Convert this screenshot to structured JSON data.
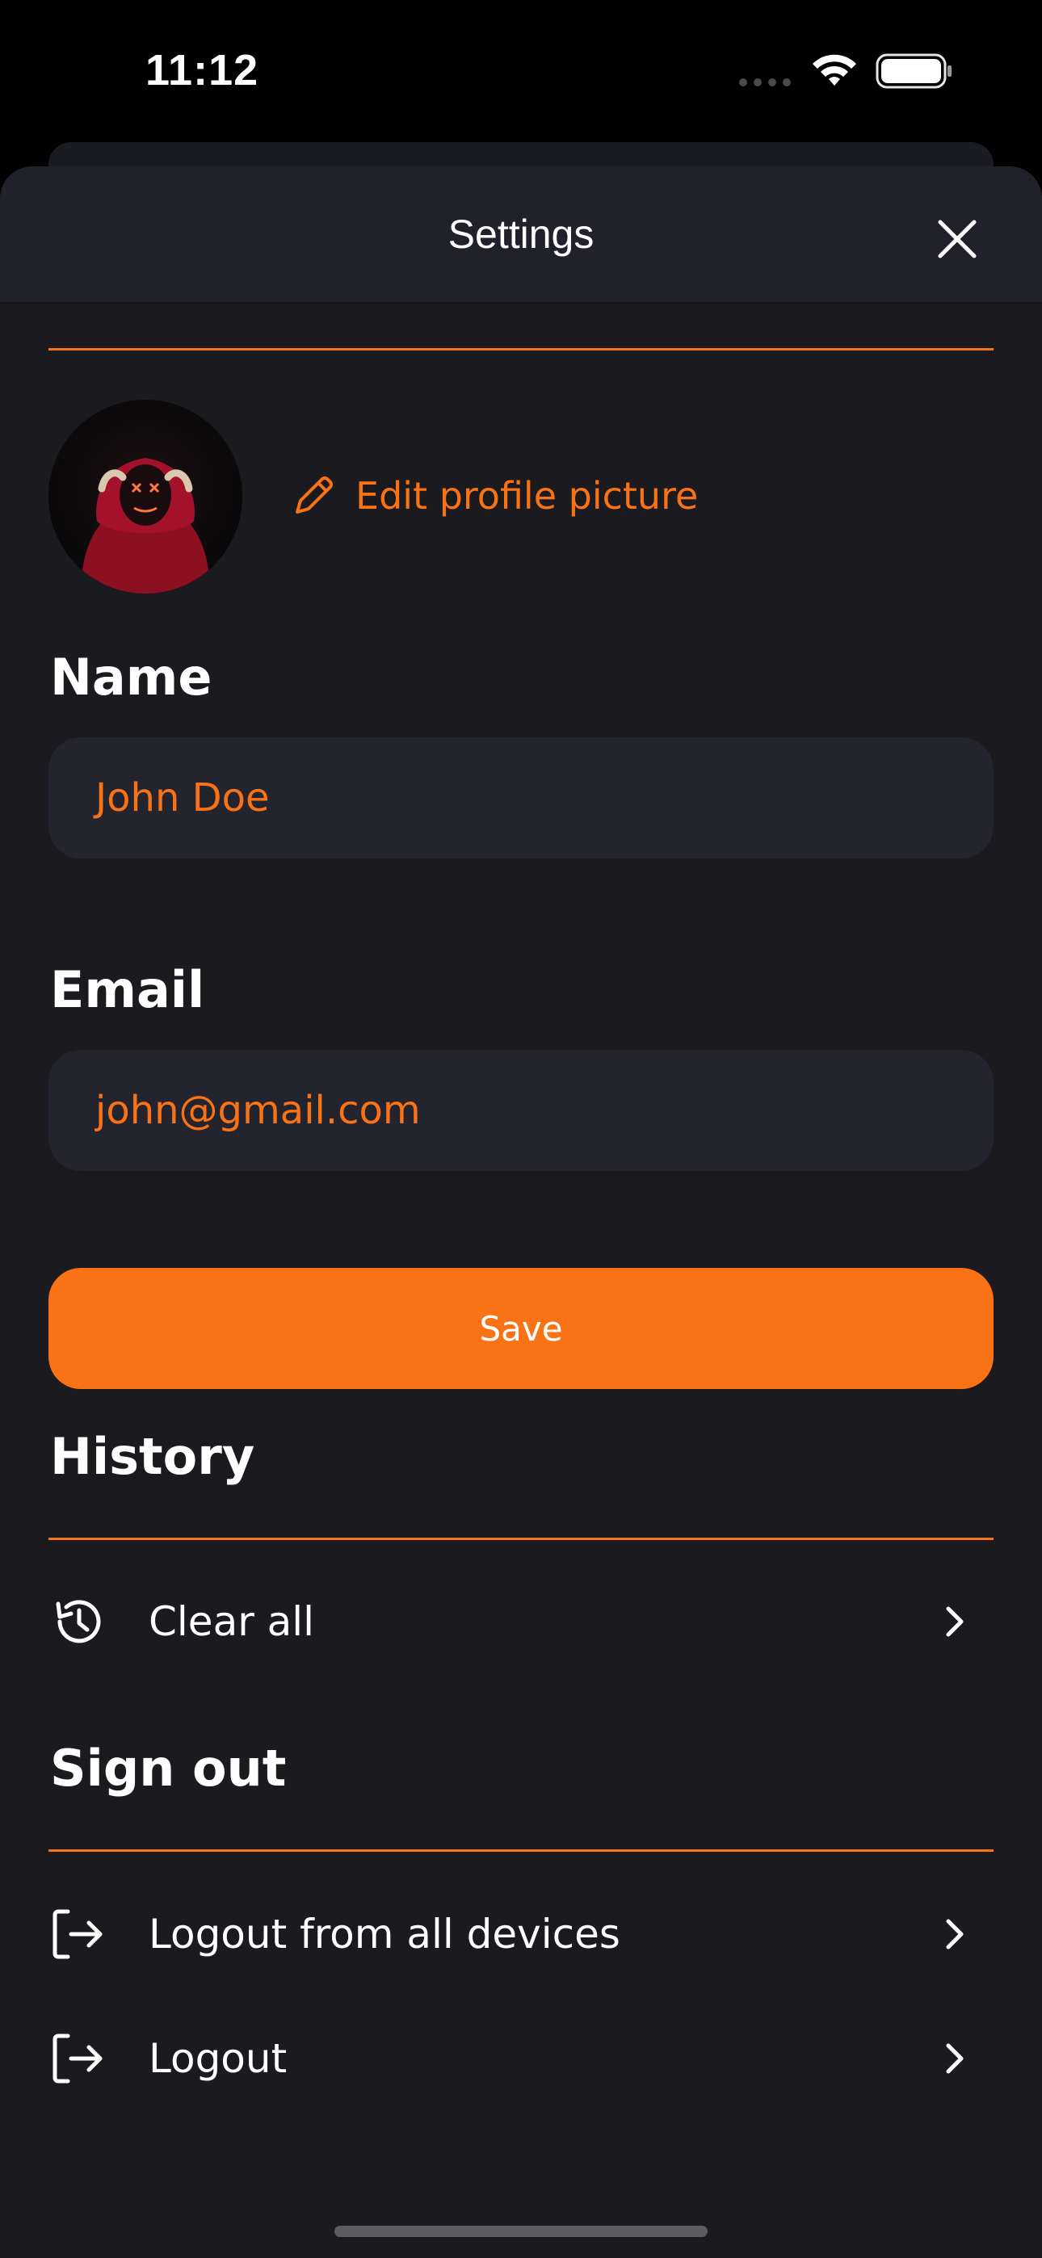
{
  "status_bar": {
    "time": "11:12"
  },
  "sheet": {
    "title": "Settings"
  },
  "profile": {
    "edit_picture_label": "Edit profile picture"
  },
  "name_section": {
    "label": "Name",
    "value": "John Doe"
  },
  "email_section": {
    "label": "Email",
    "value": "john@gmail.com"
  },
  "save_label": "Save",
  "history": {
    "title": "History",
    "items": [
      {
        "label": "Clear all",
        "icon": "history-icon"
      }
    ]
  },
  "sign_out": {
    "title": "Sign out",
    "items": [
      {
        "label": "Logout from all devices",
        "icon": "logout-icon"
      },
      {
        "label": "Logout",
        "icon": "logout-icon"
      }
    ]
  },
  "colors": {
    "accent": "#f97316",
    "sheet_background": "#1a1a1f",
    "header_background": "#20212a",
    "input_background": "#23242d",
    "text_primary": "#ffffff"
  }
}
